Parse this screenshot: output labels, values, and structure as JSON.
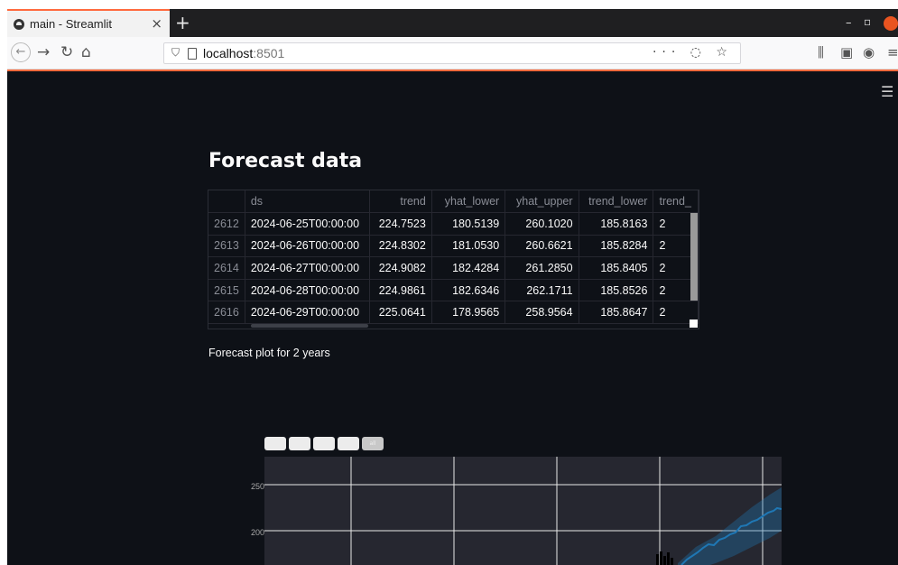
{
  "browser": {
    "tab_title": "main - Streamlit",
    "tab_close": "×",
    "new_tab": "+",
    "url_host": "localhost",
    "url_port": ":8501",
    "url_actions": "··· ◌ ☆"
  },
  "app": {
    "heading": "Forecast data",
    "subtitle": "Forecast plot for 2 years",
    "table": {
      "columns": [
        "ds",
        "trend",
        "yhat_lower",
        "yhat_upper",
        "trend_lower",
        "trend_"
      ],
      "rows": [
        {
          "index": "2612",
          "ds": "2024-06-25T00:00:00",
          "trend": "224.7523",
          "yhat_lower": "180.5139",
          "yhat_upper": "260.1020",
          "trend_lower": "185.8163",
          "trend_upper": "2"
        },
        {
          "index": "2613",
          "ds": "2024-06-26T00:00:00",
          "trend": "224.8302",
          "yhat_lower": "181.0530",
          "yhat_upper": "260.6621",
          "trend_lower": "185.8284",
          "trend_upper": "2"
        },
        {
          "index": "2614",
          "ds": "2024-06-27T00:00:00",
          "trend": "224.9082",
          "yhat_lower": "182.4284",
          "yhat_upper": "261.2850",
          "trend_lower": "185.8405",
          "trend_upper": "2"
        },
        {
          "index": "2615",
          "ds": "2024-06-28T00:00:00",
          "trend": "224.9861",
          "yhat_lower": "182.6346",
          "yhat_upper": "262.1711",
          "trend_lower": "185.8526",
          "trend_upper": "2"
        },
        {
          "index": "2616",
          "ds": "2024-06-29T00:00:00",
          "trend": "225.0641",
          "yhat_lower": "178.9565",
          "yhat_upper": "258.9564",
          "trend_lower": "185.8647",
          "trend_upper": "2"
        }
      ]
    },
    "plot": {
      "range_buttons": [
        "",
        "",
        "",
        "",
        "all"
      ],
      "y_ticks": [
        "250",
        "200"
      ]
    }
  },
  "colors": {
    "app_bg": "#0e1117",
    "plot_bg": "#262730",
    "forecast_line": "#1f77b4",
    "tab_accent": "#ff6a3d"
  }
}
